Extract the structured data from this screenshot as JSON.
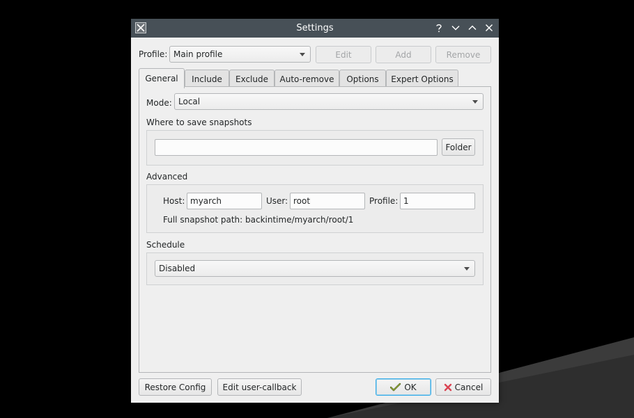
{
  "window": {
    "title": "Settings"
  },
  "profile": {
    "label": "Profile:",
    "selected": "Main profile",
    "edit_label": "Edit",
    "add_label": "Add",
    "remove_label": "Remove"
  },
  "tabs": [
    {
      "label": "General",
      "active": true
    },
    {
      "label": "Include"
    },
    {
      "label": "Exclude"
    },
    {
      "label": "Auto-remove"
    },
    {
      "label": "Options"
    },
    {
      "label": "Expert Options"
    }
  ],
  "general": {
    "mode_label": "Mode:",
    "mode_value": "Local",
    "where_label": "Where to save snapshots",
    "folder_value": "",
    "folder_button": "Folder",
    "advanced_label": "Advanced",
    "host_label": "Host:",
    "host_value": "myarch",
    "user_label": "User:",
    "user_value": "root",
    "profile_label": "Profile:",
    "profile_value": "1",
    "full_path": "Full snapshot path: backintime/myarch/root/1",
    "schedule_label": "Schedule",
    "schedule_value": "Disabled"
  },
  "footer": {
    "restore_label": "Restore Config",
    "callback_label": "Edit user-callback",
    "ok_label": "OK",
    "cancel_label": "Cancel"
  },
  "colors": {
    "titlebar": "#475057",
    "accent": "#3daee9",
    "cancel_x": "#da4453"
  }
}
